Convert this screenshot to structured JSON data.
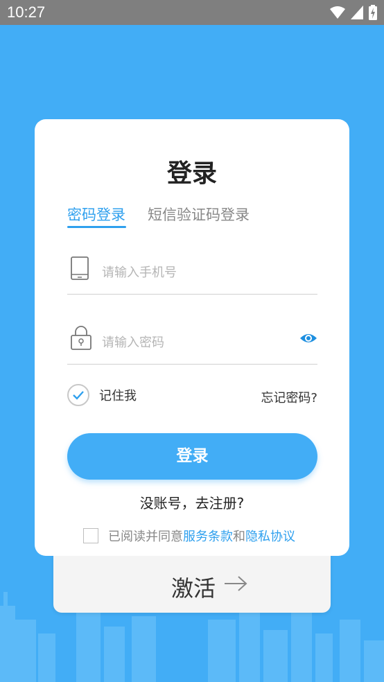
{
  "status_bar": {
    "time": "10:27"
  },
  "login": {
    "title": "登录",
    "tabs": [
      {
        "label": "密码登录",
        "active": true
      },
      {
        "label": "短信验证码登录",
        "active": false
      }
    ],
    "phone_placeholder": "请输入手机号",
    "password_placeholder": "请输入密码",
    "remember_label": "记住我",
    "remember_checked": true,
    "forgot_label": "忘记密码?",
    "submit_label": "登录",
    "register_label": "没账号，去注册?",
    "agreement": {
      "prefix": "已阅读并同意",
      "terms": "服务条款",
      "and": "和",
      "privacy": "隐私协议"
    }
  },
  "activate": {
    "label": "激活"
  },
  "colors": {
    "primary": "#42adf6",
    "link": "#2fa0ee",
    "statusbar": "#7f7f7f"
  }
}
